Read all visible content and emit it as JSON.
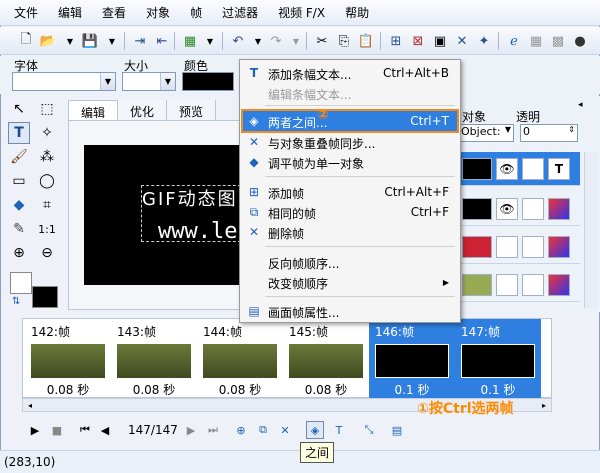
{
  "menubar": {
    "items": [
      "文件",
      "编辑",
      "查看",
      "对象",
      "帧",
      "过滤器",
      "视频 F/X",
      "帮助"
    ]
  },
  "props": {
    "font_label": "字体",
    "size_label": "大小",
    "color_label": "颜色",
    "object_label": "对象",
    "opacity_label": "透明",
    "object_value": "Object:",
    "opacity_value": "0"
  },
  "tabs": [
    "编辑",
    "优化",
    "预览"
  ],
  "canvas": {
    "line1": "GIF动态图",
    "line2": "www.le"
  },
  "context_menu": {
    "items": [
      {
        "label": "添加条幅文本...",
        "shortcut": "Ctrl+Alt+B",
        "icon": "text-banner-icon",
        "disabled": false
      },
      {
        "label": "编辑条幅文本...",
        "shortcut": "",
        "icon": "",
        "disabled": true
      },
      {
        "label": "两者之间...",
        "shortcut": "Ctrl+T",
        "icon": "tween-icon",
        "disabled": false
      },
      {
        "label": "与对象重叠帧同步...",
        "shortcut": "",
        "icon": "sync-icon",
        "disabled": false
      },
      {
        "label": "调平帧为单一对象",
        "shortcut": "",
        "icon": "flatten-icon",
        "disabled": false
      },
      {
        "label": "添加帧",
        "shortcut": "Ctrl+Alt+F",
        "icon": "add-frame-icon",
        "disabled": false
      },
      {
        "label": "相同的帧",
        "shortcut": "Ctrl+F",
        "icon": "duplicate-frame-icon",
        "disabled": false
      },
      {
        "label": "删除帧",
        "shortcut": "",
        "icon": "delete-frame-icon",
        "disabled": false
      },
      {
        "label": "反向帧顺序...",
        "shortcut": "",
        "icon": "",
        "disabled": false
      },
      {
        "label": "改变帧顺序",
        "shortcut": "",
        "icon": "",
        "disabled": false,
        "submenu": true
      },
      {
        "label": "画面帧属性...",
        "shortcut": "",
        "icon": "frame-properties-icon",
        "disabled": false
      }
    ]
  },
  "frames": [
    {
      "name": "142:帧",
      "delay": "0.08 秒",
      "selected": false,
      "thumb": "photo"
    },
    {
      "name": "143:帧",
      "delay": "0.08 秒",
      "selected": false,
      "thumb": "photo"
    },
    {
      "name": "144:帧",
      "delay": "0.08 秒",
      "selected": false,
      "thumb": "photo"
    },
    {
      "name": "145:帧",
      "delay": "0.08 秒",
      "selected": false,
      "thumb": "photo"
    },
    {
      "name": "146:帧",
      "delay": "0.1 秒",
      "selected": true,
      "thumb": "black"
    },
    {
      "name": "147:帧",
      "delay": "0.1 秒",
      "selected": true,
      "thumb": "text"
    }
  ],
  "playback": {
    "counter": "147/147"
  },
  "annotations": {
    "step2": "②",
    "step1": "①按Ctrl选两帧"
  },
  "tooltip": "之间",
  "status": {
    "coords": "(283,10)"
  },
  "colors": {
    "selection": "#2f7fe0",
    "annotation": "#ff8a00"
  }
}
